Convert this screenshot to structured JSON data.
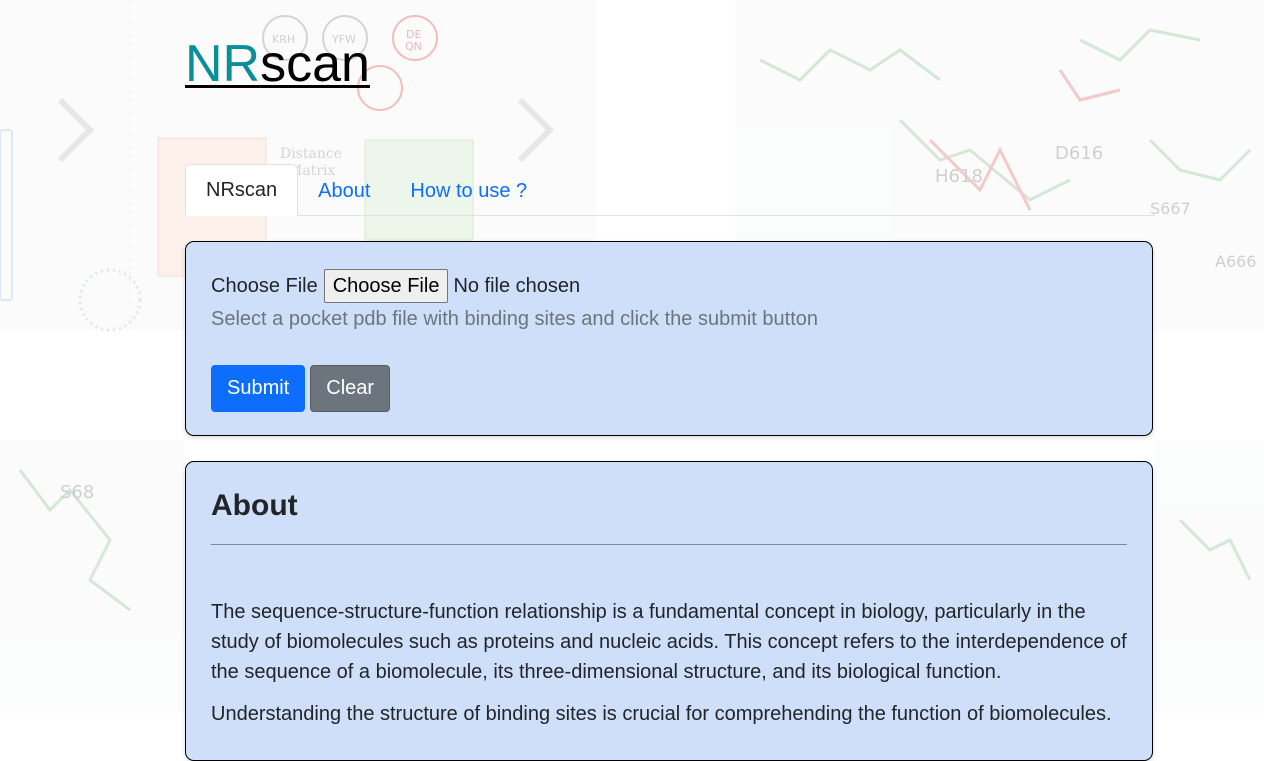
{
  "brand": {
    "accent": "NR",
    "rest": "scan"
  },
  "tabs": [
    {
      "label": "NRscan",
      "active": true
    },
    {
      "label": "About",
      "active": false
    },
    {
      "label": "How to use ?",
      "active": false
    }
  ],
  "upload": {
    "file_label": "Choose File",
    "file_button": "Choose File",
    "file_status": "No file chosen",
    "help_text": "Select a pocket pdb file with binding sites and click the submit button",
    "submit_label": "Submit",
    "clear_label": "Clear"
  },
  "about": {
    "title": "About",
    "paragraph1": "The sequence-structure-function relationship is a fundamental concept in biology, particularly in the study of biomolecules such as proteins and nucleic acids. This concept refers to the interdependence of the sequence of a biomolecule, its three-dimensional structure, and its biological function.",
    "paragraph2": "Understanding the structure of binding sites is crucial for comprehending the function of biomolecules."
  },
  "colors": {
    "brand_accent": "#0a8f99",
    "card_bg": "#cfdff9",
    "link": "#0d6efd",
    "primary": "#0d6efd",
    "secondary": "#6c757d"
  },
  "background_labels": {
    "res1": "H618",
    "res2": "D616",
    "res3": "S667",
    "res4": "A666",
    "res5": "S68",
    "box1": "Distance",
    "box2": "Matrix",
    "node1": "KRH",
    "node2": "YFW",
    "node3": "DE",
    "node4": "QN"
  }
}
